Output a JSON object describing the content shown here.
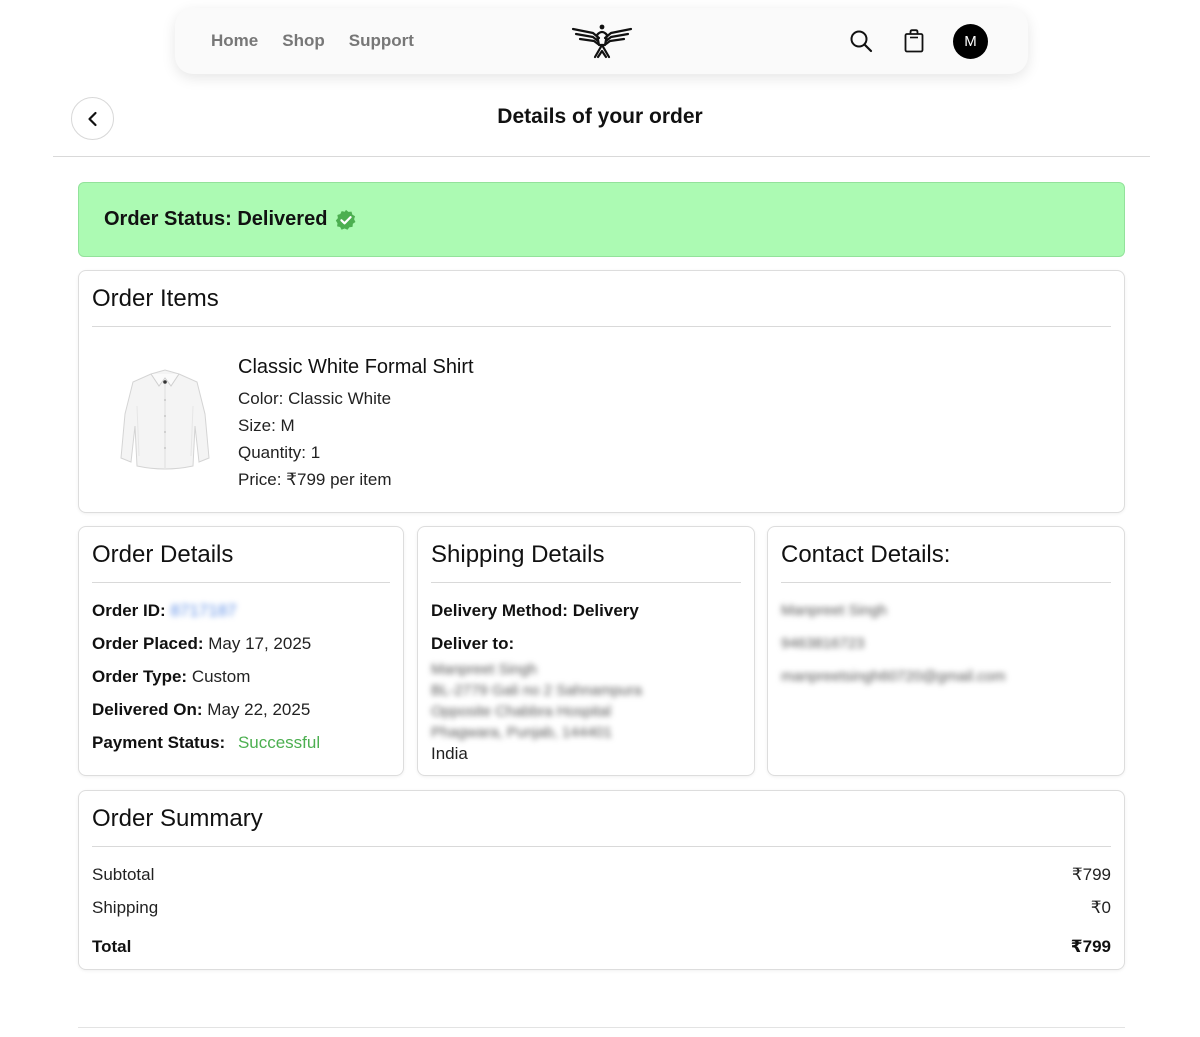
{
  "nav": {
    "links": [
      "Home",
      "Shop",
      "Support"
    ],
    "avatar_initial": "M",
    "icons": {
      "search": "search-icon",
      "cart": "shopping-bag-icon",
      "logo": "eagle-logo"
    }
  },
  "page": {
    "title": "Details of your order",
    "back_icon": "chevron-left-icon"
  },
  "status": {
    "text": "Order Status: Delivered",
    "icon": "verified-check-icon",
    "background": "#acfab3",
    "icon_color": "#4caf50"
  },
  "order_items": {
    "title": "Order Items",
    "items": [
      {
        "name": "Classic White Formal Shirt",
        "color": "Color: Classic White",
        "size": "Size: M",
        "quantity": "Quantity: 1",
        "price": "Price: ₹799 per item"
      }
    ]
  },
  "order_details": {
    "title": "Order Details",
    "id_label": "Order ID:",
    "id_value": "8717187",
    "placed_label": "Order Placed:",
    "placed_value": "May 17, 2025",
    "type_label": "Order Type:",
    "type_value": "Custom",
    "delivered_label": "Delivered On:",
    "delivered_value": "May 22, 2025",
    "payment_label": "Payment Status:",
    "payment_value": "Successful",
    "payment_color": "#4caf50"
  },
  "shipping": {
    "title": "Shipping Details",
    "method": "Delivery Method: Delivery",
    "deliver_to_label": "Deliver to:",
    "address_lines": [
      "Manpreet Singh",
      "BL-2779 Gali no 2 Sahnampura",
      "Opposite Chabbra Hospital",
      "Phagwara, Punjab, 144401"
    ],
    "country": "India"
  },
  "contact": {
    "title": "Contact Details:",
    "name": "Manpreet Singh",
    "phone": "9463816723",
    "email": "manpreetsingh60720@gmail.com"
  },
  "summary": {
    "title": "Order Summary",
    "subtotal_label": "Subtotal",
    "subtotal_value": "₹799",
    "shipping_label": "Shipping",
    "shipping_value": "₹0",
    "total_label": "Total",
    "total_value": "₹799"
  }
}
